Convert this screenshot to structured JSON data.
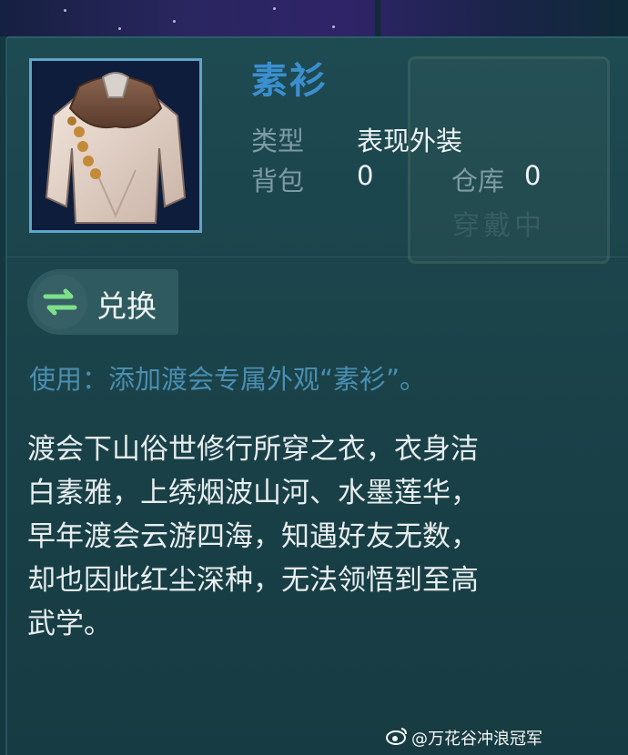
{
  "item": {
    "name": "素衫",
    "type_label": "类型",
    "type_value": "表现外装",
    "bag_label": "背包",
    "bag_value": "0",
    "warehouse_label": "仓库",
    "warehouse_value": "0",
    "icon": "robe-garment-icon"
  },
  "background_card": {
    "status_text": "穿戴中"
  },
  "actions": {
    "exchange_label": "兑换",
    "exchange_icon": "swap-arrows-icon"
  },
  "usage": "使用：添加渡会专属外观“素衫”。",
  "description": {
    "lines": [
      "渡会下山俗世修行所穿之衣，衣身洁",
      "白素雅，上绣烟波山河、水墨莲华，",
      "早年渡会云游四海，知遇好友无数，",
      "却也因此红尘深种，无法领悟到至高",
      "武学。"
    ]
  },
  "watermark": {
    "text": "@万花谷冲浪冠军",
    "icon": "weibo-icon"
  },
  "colors": {
    "panel_bg": "#1a4249",
    "title_blue": "#3b8fce",
    "usage_blue": "#4a8eb0",
    "label_gray": "#7e9ba4",
    "icon_border": "#5fa5c7",
    "exchange_green": "#7ee08a"
  }
}
